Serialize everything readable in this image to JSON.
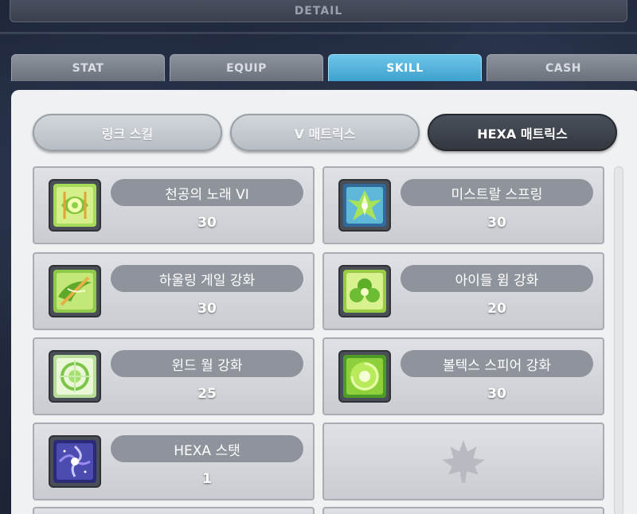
{
  "header": {
    "title": "DETAIL"
  },
  "tabs": [
    {
      "label": "STAT"
    },
    {
      "label": "EQUIP"
    },
    {
      "label": "SKILL",
      "active": true
    },
    {
      "label": "CASH"
    }
  ],
  "subtabs": [
    {
      "label": "링크 스킬"
    },
    {
      "label": "V 매트릭스"
    },
    {
      "label": "HEXA 매트릭스",
      "active": true
    }
  ],
  "skills": [
    {
      "name": "천공의 노래 VI",
      "level": "30",
      "icon": "song-of-heaven-icon"
    },
    {
      "name": "미스트랄 스프링",
      "level": "30",
      "icon": "mistral-spring-icon"
    },
    {
      "name": "하울링 게일 강화",
      "level": "30",
      "icon": "howling-gale-icon"
    },
    {
      "name": "아이들 윔 강화",
      "level": "20",
      "icon": "idle-whim-icon"
    },
    {
      "name": "윈드 월 강화",
      "level": "25",
      "icon": "wind-wall-icon"
    },
    {
      "name": "볼텍스 스피어 강화",
      "level": "30",
      "icon": "vortex-sphere-icon"
    },
    {
      "name": "HEXA 스탯",
      "level": "1",
      "icon": "hexa-stat-icon"
    }
  ],
  "empty_slot": {
    "icon": "maple-leaf-icon"
  },
  "colors": {
    "active_tab": "#3fa1cf",
    "active_subtab": "#33383f",
    "pill": "#8f949c",
    "panel": "#f0f1f3"
  }
}
